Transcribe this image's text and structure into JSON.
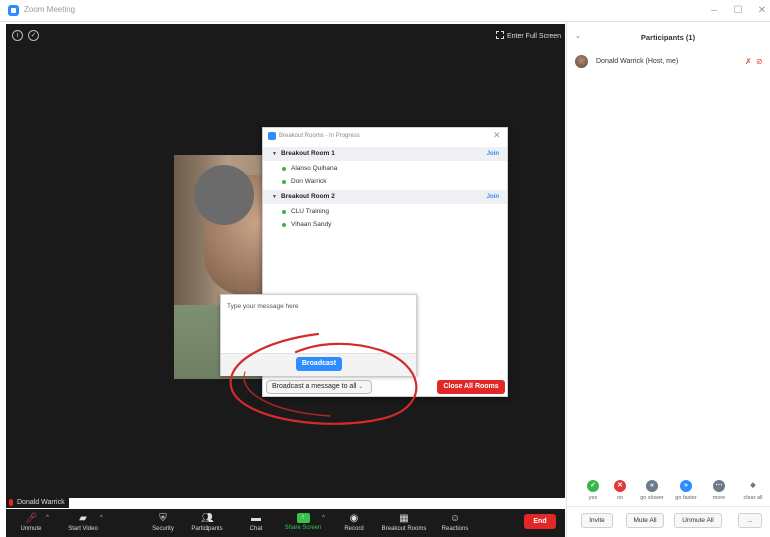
{
  "window": {
    "title": "Zoom Meeting",
    "minimize_glyph": "–",
    "maximize_glyph": "☐",
    "close_glyph": "✕"
  },
  "video": {
    "info_icon": "info-icon",
    "security_icon": "shield-icon",
    "fullscreen_label": "Enter Full Screen"
  },
  "breakout": {
    "title": "Breakout Rooms - In Progress",
    "close_glyph": "✕",
    "rooms": [
      {
        "name": "Breakout Room 1",
        "join_label": "Join",
        "members": [
          "Alanso Quihana",
          "Don Warrick"
        ]
      },
      {
        "name": "Breakout Room 2",
        "join_label": "Join",
        "members": [
          "CLU Training",
          "Vihaan Sandy"
        ]
      }
    ],
    "broadcast_select": "Broadcast a message to all",
    "close_all_label": "Close All Rooms"
  },
  "message_popup": {
    "placeholder": "Type your message here",
    "broadcast_label": "Broadcast"
  },
  "name_label": "Donald Warrick",
  "toolbar": {
    "unmute": "Unmute",
    "start_video": "Start Video",
    "security": "Security",
    "participants": "Participants",
    "participants_count": "1",
    "chat": "Chat",
    "share_screen": "Share Screen",
    "record": "Record",
    "breakout_rooms": "Breakout Rooms",
    "reactions": "Reactions",
    "end": "End"
  },
  "participants_panel": {
    "header": "Participants (1)",
    "participant_name": "Donald Warrick (Host, me)",
    "feedback": [
      {
        "label": "yes",
        "glyph": "✓",
        "color": "#39b54a"
      },
      {
        "label": "no",
        "glyph": "✕",
        "color": "#e03a3a"
      },
      {
        "label": "go slower",
        "glyph": "«",
        "color": "#6c7a8c"
      },
      {
        "label": "go faster",
        "glyph": "»",
        "color": "#2d8cff"
      },
      {
        "label": "more",
        "glyph": "⋯",
        "color": "#6c7a8c"
      },
      {
        "label": "clear all",
        "glyph": "◆",
        "color": "#6c7a8c"
      }
    ],
    "invite": "Invite",
    "mute_all": "Mute All",
    "unmute_all": "Unmute All",
    "more": "..."
  },
  "colors": {
    "accent": "#2d8cff",
    "danger": "#e02828",
    "share_green": "#39c24b",
    "annotation_red": "#d42a2a"
  }
}
